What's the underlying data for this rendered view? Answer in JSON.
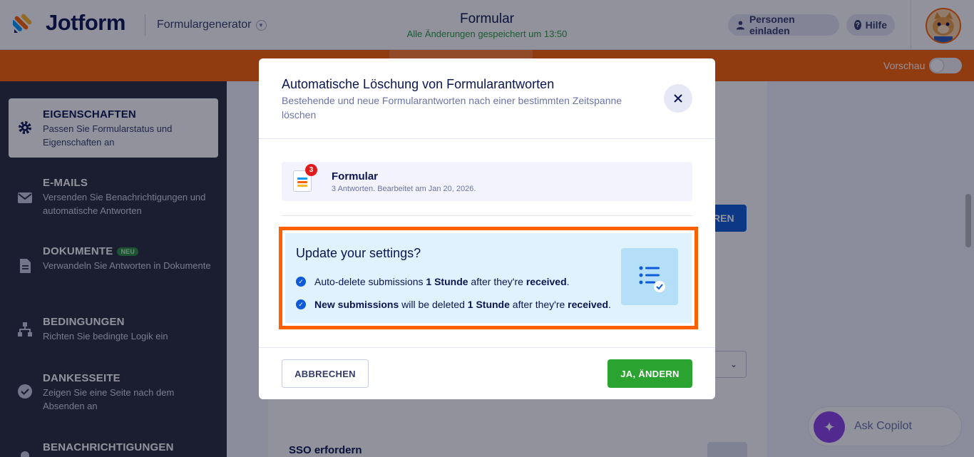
{
  "header": {
    "brand": "Jotform",
    "builder_label": "Formulargenerator",
    "form_title": "Formular",
    "save_status": "Alle Änderungen gespeichert um 13:50",
    "invite_label": "Personen einladen",
    "help_label": "Hilfe"
  },
  "toolbar": {
    "preview_label": "Vorschau"
  },
  "sidebar": {
    "items": [
      {
        "title": "EIGENSCHAFTEN",
        "desc": "Passen Sie Formularstatus und Eigenschaften an",
        "icon": "gear-icon"
      },
      {
        "title": "E-MAILS",
        "desc": "Versenden Sie Benachrichtigungen und automatische Antworten",
        "icon": "envelope-icon"
      },
      {
        "title": "DOKUMENTE",
        "badge": "NEU",
        "desc": "Verwandeln Sie Antworten in Dokumente",
        "icon": "document-icon"
      },
      {
        "title": "BEDINGUNGEN",
        "desc": "Richten Sie bedingte Logik ein",
        "icon": "sitemap-icon"
      },
      {
        "title": "DANKESSEITE",
        "desc": "Zeigen Sie eine Seite nach dem Absenden an",
        "icon": "check-circle-icon"
      },
      {
        "title": "BENACHRICHTIGUNGEN",
        "desc": "",
        "icon": "bell-icon"
      }
    ]
  },
  "background": {
    "button_fragment": "REN",
    "sso_label": "SSO erfordern",
    "copilot_label": "Ask Copilot"
  },
  "modal": {
    "title": "Automatische Löschung von Formularantworten",
    "subtitle": "Bestehende und neue Formularantworten nach einer bestimmten Zeitspanne löschen",
    "form": {
      "name": "Formular",
      "meta": "3 Antworten. Bearbeitet am Jan 20, 2026.",
      "badge_count": "3"
    },
    "settings": {
      "title": "Update your settings?",
      "row1": {
        "a": "Auto-delete submissions ",
        "b": "1 Stunde",
        "c": " after they're ",
        "d": "received",
        "e": "."
      },
      "row2": {
        "a": "New submissions",
        "b": " will be deleted ",
        "c": "1 Stunde",
        "d": " after they're ",
        "e": "received",
        "f": "."
      }
    },
    "cancel_label": "ABBRECHEN",
    "confirm_label": "JA, ÄNDERN"
  },
  "colors": {
    "brand_orange": "#ff6100",
    "confirm_green": "#2ba330",
    "primary_blue": "#0d5bd8",
    "navy": "#0a1551"
  }
}
